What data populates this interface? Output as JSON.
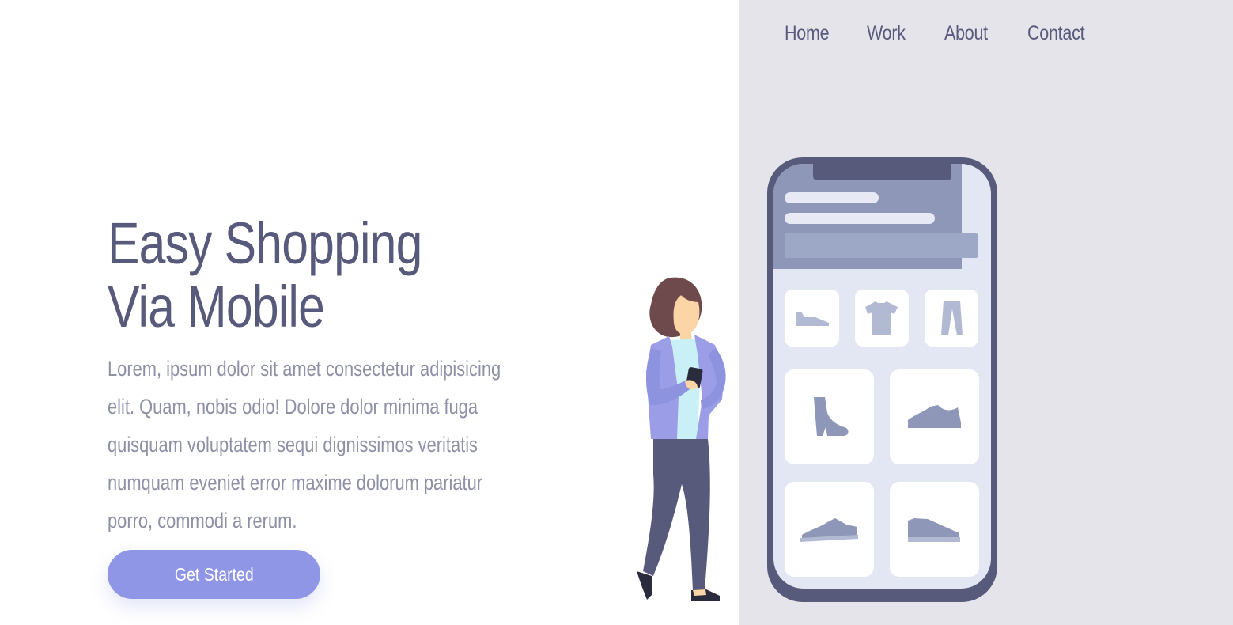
{
  "nav": {
    "links": [
      {
        "label": "Home"
      },
      {
        "label": "Work"
      },
      {
        "label": "About"
      },
      {
        "label": "Contact"
      }
    ]
  },
  "hero": {
    "title_line1": "Easy Shopping",
    "title_line2": "Via Mobile",
    "description": "Lorem, ipsum dolor sit amet consectetur adipisicing elit. Quam, nobis odio! Dolore dolor minima fuga quisquam voluptatem sequi dignissimos veritatis numquam eveniet error maxime dolorum pariatur porro, commodi a rerum.",
    "cta_label": "Get Started"
  },
  "illustration": {
    "phone_categories": [
      "flat-shoe-icon",
      "tshirt-icon",
      "pants-icon"
    ],
    "phone_products": [
      "boot-icon",
      "sneaker-icon",
      "sneaker-icon",
      "sneaker-icon"
    ]
  },
  "colors": {
    "primary_text": "#585a7c",
    "body_text": "#8e90a6",
    "accent": "#8f96e6",
    "panel_bg": "#e5e4ea",
    "phone_frame": "#585a7c"
  }
}
